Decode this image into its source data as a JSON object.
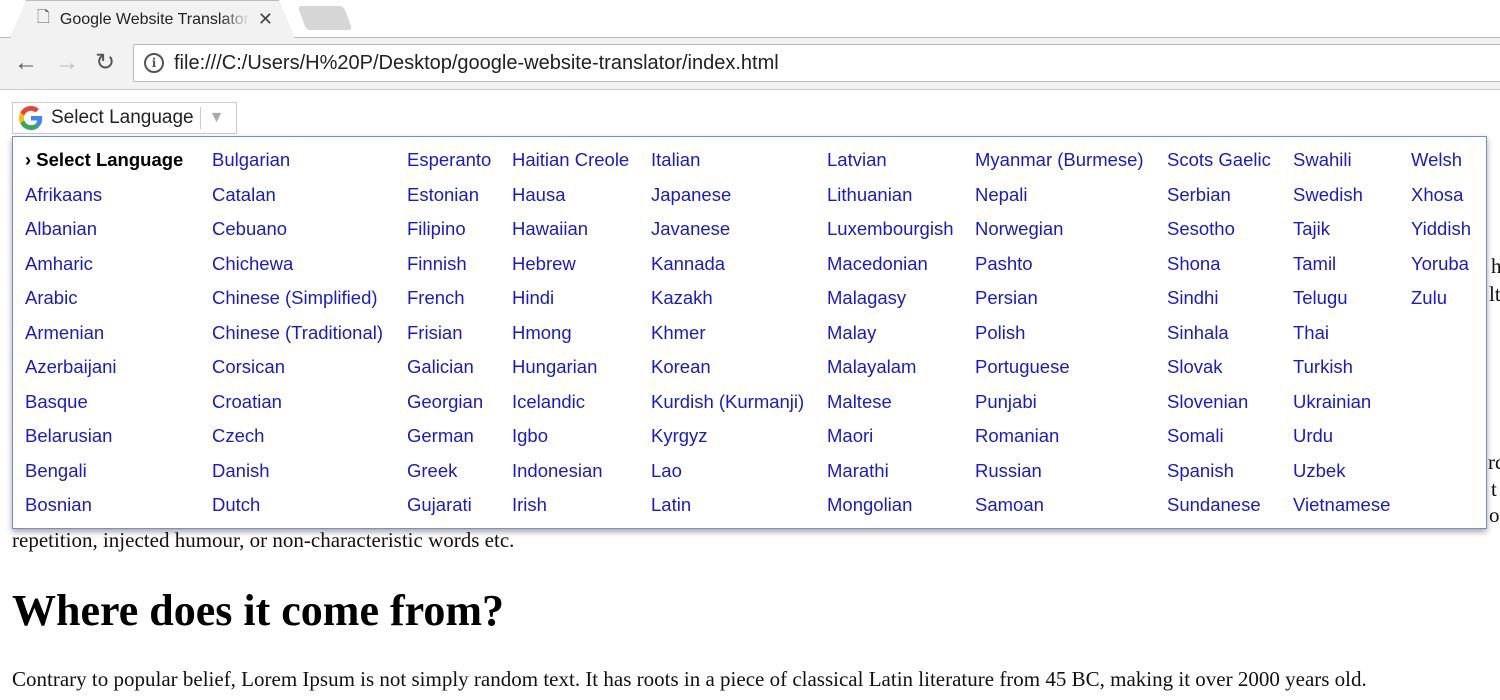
{
  "browser": {
    "tab_title": "Google Website Translator",
    "url": "file:///C:/Users/H%20P/Desktop/google-website-translator/index.html"
  },
  "translate": {
    "label": "Select Language",
    "arrow": "▼"
  },
  "menu": {
    "columns": [
      [
        "› Select Language",
        "Afrikaans",
        "Albanian",
        "Amharic",
        "Arabic",
        "Armenian",
        "Azerbaijani",
        "Basque",
        "Belarusian",
        "Bengali",
        "Bosnian"
      ],
      [
        "Bulgarian",
        "Catalan",
        "Cebuano",
        "Chichewa",
        "Chinese (Simplified)",
        "Chinese (Traditional)",
        "Corsican",
        "Croatian",
        "Czech",
        "Danish",
        "Dutch"
      ],
      [
        "Esperanto",
        "Estonian",
        "Filipino",
        "Finnish",
        "French",
        "Frisian",
        "Galician",
        "Georgian",
        "German",
        "Greek",
        "Gujarati"
      ],
      [
        "Haitian Creole",
        "Hausa",
        "Hawaiian",
        "Hebrew",
        "Hindi",
        "Hmong",
        "Hungarian",
        "Icelandic",
        "Igbo",
        "Indonesian",
        "Irish"
      ],
      [
        "Italian",
        "Japanese",
        "Javanese",
        "Kannada",
        "Kazakh",
        "Khmer",
        "Korean",
        "Kurdish (Kurmanji)",
        "Kyrgyz",
        "Lao",
        "Latin"
      ],
      [
        "Latvian",
        "Lithuanian",
        "Luxembourgish",
        "Macedonian",
        "Malagasy",
        "Malay",
        "Malayalam",
        "Maltese",
        "Maori",
        "Marathi",
        "Mongolian"
      ],
      [
        "Myanmar (Burmese)",
        "Nepali",
        "Norwegian",
        "Pashto",
        "Persian",
        "Polish",
        "Portuguese",
        "Punjabi",
        "Romanian",
        "Russian",
        "Samoan"
      ],
      [
        "Scots Gaelic",
        "Serbian",
        "Sesotho",
        "Shona",
        "Sindhi",
        "Sinhala",
        "Slovak",
        "Slovenian",
        "Somali",
        "Spanish",
        "Sundanese"
      ],
      [
        "Swahili",
        "Swedish",
        "Tajik",
        "Tamil",
        "Telugu",
        "Thai",
        "Turkish",
        "Ukrainian",
        "Urdu",
        "Uzbek",
        "Vietnamese"
      ],
      [
        "Welsh",
        "Xhosa",
        "Yiddish",
        "Yoruba",
        "Zulu"
      ]
    ]
  },
  "page": {
    "fragments": [
      "h",
      "lt",
      "rd",
      "t",
      "o"
    ],
    "partial_line": "repetition, injected humour, or non-characteristic words etc.",
    "heading": "Where does it come from?",
    "paragraph": "Contrary to popular belief, Lorem Ipsum is not simply random text. It has roots in a piece of classical Latin literature from 45 BC, making it over 2000 years old."
  }
}
